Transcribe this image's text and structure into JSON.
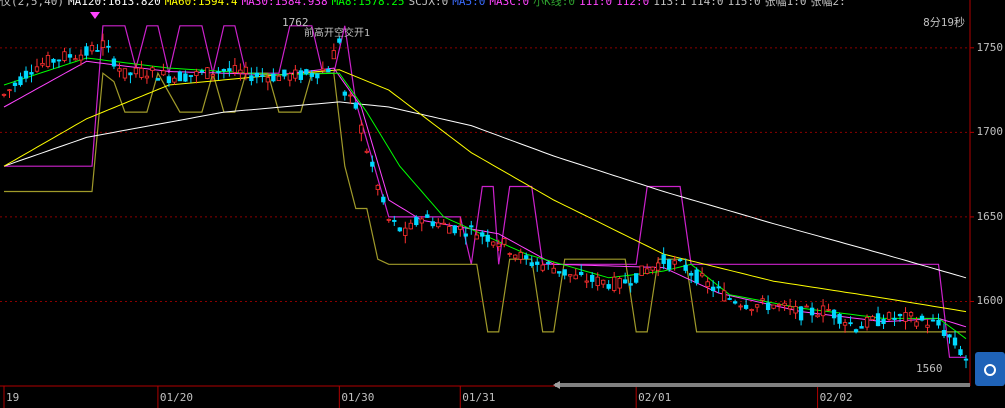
{
  "legend": [
    {
      "text": "仪(2,5,40)",
      "color": "#c0c0c0"
    },
    {
      "text": "MA120:1613.820",
      "color": "#ffffff"
    },
    {
      "text": "MA60:1594.4",
      "color": "#ffff00"
    },
    {
      "text": "MA30:1584.938",
      "color": "#ff44ff"
    },
    {
      "text": "MA8:1578.25",
      "color": "#00ff00"
    },
    {
      "text": "SCJX:0",
      "color": "#c0c0c0"
    },
    {
      "text": "MA5:0",
      "color": "#3a6bff"
    },
    {
      "text": "MA3C:0",
      "color": "#ff44ff"
    },
    {
      "text": "小K线:0",
      "color": "#2ea02e"
    },
    {
      "text": "111:0",
      "color": "#ff44ff"
    },
    {
      "text": "112:0",
      "color": "#ff44ff"
    },
    {
      "text": "113:1",
      "color": "#c0c0c0"
    },
    {
      "text": "114:0",
      "color": "#c0c0c0"
    },
    {
      "text": "115:0",
      "color": "#c0c0c0"
    },
    {
      "text": "张幅1:0",
      "color": "#c0c0c0"
    },
    {
      "text": "张幅2:",
      "color": "#c0c0c0"
    }
  ],
  "timer": "8分19秒",
  "annotations": {
    "high_value": "1762",
    "high_text": "前高开空交开1",
    "low_value": "1560"
  },
  "chart_data": {
    "type": "candlestick",
    "ylim": [
      1550,
      1770
    ],
    "yticks": [
      1750,
      1700,
      1650,
      1600
    ],
    "xticks": [
      {
        "label": "19",
        "i": 0
      },
      {
        "label": "01/20",
        "i": 28
      },
      {
        "label": "01/30",
        "i": 61
      },
      {
        "label": "01/31",
        "i": 83
      },
      {
        "label": "02/01",
        "i": 115
      },
      {
        "label": "02/02",
        "i": 148
      }
    ],
    "candles_count": 176,
    "anchors": [
      [
        0,
        1722
      ],
      [
        5,
        1738
      ],
      [
        10,
        1744
      ],
      [
        15,
        1747
      ],
      [
        18,
        1752
      ],
      [
        22,
        1734
      ],
      [
        26,
        1736
      ],
      [
        30,
        1733
      ],
      [
        35,
        1734
      ],
      [
        40,
        1737
      ],
      [
        45,
        1734
      ],
      [
        50,
        1733
      ],
      [
        55,
        1734
      ],
      [
        59,
        1738
      ],
      [
        61,
        1755
      ],
      [
        62,
        1722
      ],
      [
        64,
        1715
      ],
      [
        66,
        1690
      ],
      [
        68,
        1668
      ],
      [
        70,
        1648
      ],
      [
        73,
        1640
      ],
      [
        76,
        1650
      ],
      [
        80,
        1645
      ],
      [
        85,
        1642
      ],
      [
        90,
        1636
      ],
      [
        95,
        1624
      ],
      [
        100,
        1620
      ],
      [
        104,
        1614
      ],
      [
        108,
        1612
      ],
      [
        112,
        1610
      ],
      [
        116,
        1617
      ],
      [
        120,
        1624
      ],
      [
        124,
        1620
      ],
      [
        128,
        1610
      ],
      [
        132,
        1602
      ],
      [
        136,
        1598
      ],
      [
        140,
        1598
      ],
      [
        145,
        1593
      ],
      [
        150,
        1595
      ],
      [
        155,
        1585
      ],
      [
        160,
        1590
      ],
      [
        165,
        1590
      ],
      [
        170,
        1586
      ],
      [
        173,
        1575
      ],
      [
        175,
        1566
      ]
    ],
    "ma": [
      {
        "name": "MA120",
        "color": "#ffffff",
        "pts": [
          [
            0,
            1680
          ],
          [
            15,
            1697
          ],
          [
            40,
            1712
          ],
          [
            61,
            1718
          ],
          [
            70,
            1715
          ],
          [
            85,
            1704
          ],
          [
            100,
            1686
          ],
          [
            120,
            1665
          ],
          [
            140,
            1646
          ],
          [
            160,
            1628
          ],
          [
            175,
            1614
          ]
        ]
      },
      {
        "name": "MA60",
        "color": "#ffff00",
        "pts": [
          [
            0,
            1680
          ],
          [
            15,
            1708
          ],
          [
            30,
            1728
          ],
          [
            50,
            1734
          ],
          [
            61,
            1737
          ],
          [
            70,
            1725
          ],
          [
            85,
            1688
          ],
          [
            100,
            1660
          ],
          [
            120,
            1628
          ],
          [
            140,
            1612
          ],
          [
            160,
            1602
          ],
          [
            175,
            1594
          ]
        ]
      },
      {
        "name": "MA30",
        "color": "#ff44ff",
        "pts": [
          [
            0,
            1715
          ],
          [
            15,
            1742
          ],
          [
            30,
            1736
          ],
          [
            50,
            1734
          ],
          [
            60,
            1738
          ],
          [
            65,
            1715
          ],
          [
            70,
            1660
          ],
          [
            76,
            1648
          ],
          [
            90,
            1640
          ],
          [
            100,
            1622
          ],
          [
            120,
            1620
          ],
          [
            130,
            1605
          ],
          [
            145,
            1594
          ],
          [
            160,
            1588
          ],
          [
            170,
            1590
          ],
          [
            175,
            1585
          ]
        ]
      },
      {
        "name": "MA8",
        "color": "#00ff00",
        "pts": [
          [
            0,
            1728
          ],
          [
            15,
            1744
          ],
          [
            30,
            1738
          ],
          [
            50,
            1734
          ],
          [
            61,
            1735
          ],
          [
            66,
            1712
          ],
          [
            72,
            1680
          ],
          [
            80,
            1650
          ],
          [
            95,
            1628
          ],
          [
            110,
            1614
          ],
          [
            120,
            1618
          ],
          [
            125,
            1622
          ],
          [
            132,
            1604
          ],
          [
            145,
            1596
          ],
          [
            160,
            1590
          ],
          [
            170,
            1590
          ],
          [
            175,
            1578
          ]
        ]
      }
    ],
    "signal_magenta": [
      [
        0,
        1680
      ],
      [
        16,
        1680
      ],
      [
        18,
        1763
      ],
      [
        22,
        1763
      ],
      [
        24,
        1738
      ],
      [
        26,
        1763
      ],
      [
        28,
        1763
      ],
      [
        30,
        1735
      ],
      [
        32,
        1763
      ],
      [
        36,
        1763
      ],
      [
        38,
        1735
      ],
      [
        40,
        1763
      ],
      [
        42,
        1763
      ],
      [
        44,
        1735
      ],
      [
        50,
        1735
      ],
      [
        52,
        1763
      ],
      [
        56,
        1763
      ],
      [
        58,
        1735
      ],
      [
        60,
        1735
      ],
      [
        62,
        1763
      ],
      [
        64,
        1718
      ],
      [
        70,
        1650
      ],
      [
        80,
        1650
      ],
      [
        83,
        1650
      ],
      [
        85,
        1622
      ],
      [
        87,
        1668
      ],
      [
        89,
        1668
      ],
      [
        90,
        1622
      ],
      [
        92,
        1668
      ],
      [
        96,
        1668
      ],
      [
        98,
        1622
      ],
      [
        115,
        1622
      ],
      [
        117,
        1668
      ],
      [
        123,
        1668
      ],
      [
        125,
        1622
      ],
      [
        170,
        1622
      ],
      [
        172,
        1567
      ],
      [
        175,
        1567
      ]
    ],
    "signal_olive": [
      [
        0,
        1665
      ],
      [
        16,
        1665
      ],
      [
        18,
        1735
      ],
      [
        20,
        1730
      ],
      [
        22,
        1712
      ],
      [
        26,
        1712
      ],
      [
        28,
        1735
      ],
      [
        32,
        1712
      ],
      [
        36,
        1712
      ],
      [
        38,
        1735
      ],
      [
        40,
        1712
      ],
      [
        42,
        1712
      ],
      [
        44,
        1735
      ],
      [
        48,
        1735
      ],
      [
        50,
        1712
      ],
      [
        54,
        1712
      ],
      [
        56,
        1735
      ],
      [
        60,
        1735
      ],
      [
        62,
        1680
      ],
      [
        64,
        1655
      ],
      [
        66,
        1655
      ],
      [
        68,
        1625
      ],
      [
        70,
        1622
      ],
      [
        86,
        1622
      ],
      [
        88,
        1582
      ],
      [
        90,
        1582
      ],
      [
        92,
        1625
      ],
      [
        96,
        1625
      ],
      [
        98,
        1582
      ],
      [
        100,
        1582
      ],
      [
        102,
        1625
      ],
      [
        113,
        1625
      ],
      [
        115,
        1582
      ],
      [
        117,
        1582
      ],
      [
        119,
        1625
      ],
      [
        124,
        1625
      ],
      [
        126,
        1582
      ],
      [
        175,
        1582
      ]
    ]
  }
}
